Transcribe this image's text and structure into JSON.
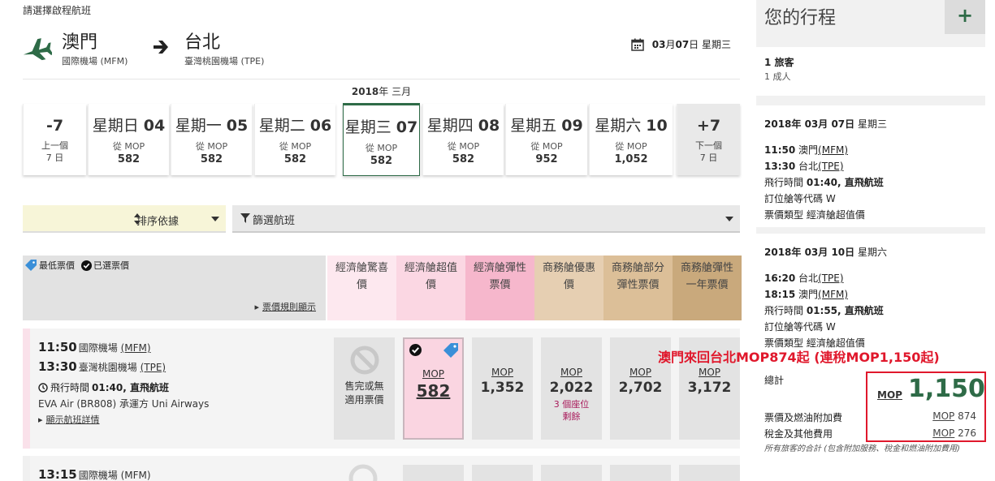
{
  "prompt": "請選擇啟程航班",
  "route": {
    "from_city": "澳門",
    "from_airport": "國際機場 (MFM)",
    "to_city": "台北",
    "to_airport": "臺灣桃園機場 (TPE)",
    "date_bold": "03",
    "date_month": "月 ",
    "date_day": "07",
    "date_rest": "日 星期三"
  },
  "month_bar": {
    "year": "2018",
    "year_suffix": "年 三月"
  },
  "date_tabs": {
    "prev": {
      "value": "-7",
      "line1": "上一個",
      "line2": "7 日"
    },
    "days": [
      {
        "weekday": "星期日",
        "day": "04",
        "from": "從 MOP",
        "price": "582"
      },
      {
        "weekday": "星期一",
        "day": "05",
        "from": "從 MOP",
        "price": "582"
      },
      {
        "weekday": "星期二",
        "day": "06",
        "from": "從 MOP",
        "price": "582"
      },
      {
        "weekday": "星期三",
        "day": "07",
        "from": "從 MOP",
        "price": "582"
      },
      {
        "weekday": "星期四",
        "day": "08",
        "from": "從 MOP",
        "price": "582"
      },
      {
        "weekday": "星期五",
        "day": "09",
        "from": "從 MOP",
        "price": "952"
      },
      {
        "weekday": "星期六",
        "day": "10",
        "from": "從 MOP",
        "price": "1,052"
      }
    ],
    "next": {
      "value": "+7",
      "line1": "下一個",
      "line2": "7 日"
    }
  },
  "toolbar": {
    "sort_label": "排序依據",
    "filter_label": "篩選航班"
  },
  "legend": {
    "lowest": "最低票價",
    "selected": "已選票價",
    "rules_link": "票價規則顯示"
  },
  "fare_columns": [
    {
      "line1": "經濟艙驚喜",
      "line2": "價",
      "bg": "#fde8ef"
    },
    {
      "line1": "經濟艙超值",
      "line2": "價",
      "bg": "#fbd7e3"
    },
    {
      "line1": "經濟艙彈性",
      "line2": "票價",
      "bg": "#f6b7cc"
    },
    {
      "line1": "商務艙優惠",
      "line2": "價",
      "bg": "#e6cfb2"
    },
    {
      "line1": "商務艙部分",
      "line2": "彈性票價",
      "bg": "#dcbf98"
    },
    {
      "line1": "商務艙彈性",
      "line2": "一年票價",
      "bg": "#c9a97c"
    }
  ],
  "flight1": {
    "dep_time": "11:50",
    "dep_airport_prefix": "國際機場 ",
    "dep_code": "(MFM)",
    "arr_time": "13:30",
    "arr_airport_prefix": "臺灣桃園機場 ",
    "arr_code": "(TPE)",
    "duration_label": "飛行時間",
    "duration_value": "01:40, 直飛航班",
    "carrier": "EVA Air (BR808) 承運方 Uni Airways",
    "details_link": "顯示航班詳情",
    "sold_text1": "售完或無",
    "sold_text2": "適用票價",
    "fares": [
      {
        "cur": "MOP",
        "amt": "582"
      },
      {
        "cur": "MOP",
        "amt": "1,352"
      },
      {
        "cur": "MOP",
        "amt": "2,022",
        "seats1": "3 個座位",
        "seats2": "剩餘"
      },
      {
        "cur": "MOP",
        "amt": "2,702"
      },
      {
        "cur": "MOP",
        "amt": "3,172"
      }
    ]
  },
  "flight2": {
    "dep_time": "13:15",
    "dep_airport_prefix": "國際機場 ",
    "dep_code": "(MFM)"
  },
  "sidebar": {
    "title": "您的行程",
    "plus": "+",
    "pax_main": "1 旅客",
    "pax_sub": "1 成人",
    "trip1": {
      "date": "2018年 03月 07日",
      "weekday": " 星期三",
      "dep": "11:50",
      "dep_city": " 澳門",
      "dep_code": "(MFM)",
      "arr": "13:30",
      "arr_city": " 台北",
      "arr_code": "(TPE)",
      "duration_lbl": "飛行時間 ",
      "duration_val": "01:40",
      "duration_tail": ", 直飛航班",
      "booking_class": "訂位艙等代碼 W",
      "fare_type": "票價類型 經濟艙超值價"
    },
    "trip2": {
      "date": "2018年 03月 10日",
      "weekday": " 星期六",
      "dep": "16:20",
      "dep_city": " 台北",
      "dep_code": "(TPE)",
      "arr": "18:15",
      "arr_city": " 澳門",
      "arr_code": "(MFM)",
      "duration_lbl": "飛行時間 ",
      "duration_val": "01:55",
      "duration_tail": ", 直飛航班",
      "booking_class": "訂位艙等代碼 W",
      "fare_type": "票價類型 經濟艙超值價"
    },
    "total_label": "總計",
    "total_cur": "MOP",
    "total_amt": "1,150",
    "fare_fuel_label": "票價及燃油附加費",
    "fare_fuel_cur": "MOP",
    "fare_fuel_amt": " 874",
    "tax_label": "稅金及其他費用",
    "tax_cur": "MOP",
    "tax_amt": " 276",
    "all_pax_note": "所有旅客的合計 (包含附加服務、稅金和燃油附加費用)"
  },
  "promo_text": "澳門來回台北MOP874起 (連稅MOP1,150起)",
  "colors": {
    "brand_green": "#2e6b47",
    "highlight_red": "#e0182c",
    "seat_warn": "#a8195a"
  }
}
